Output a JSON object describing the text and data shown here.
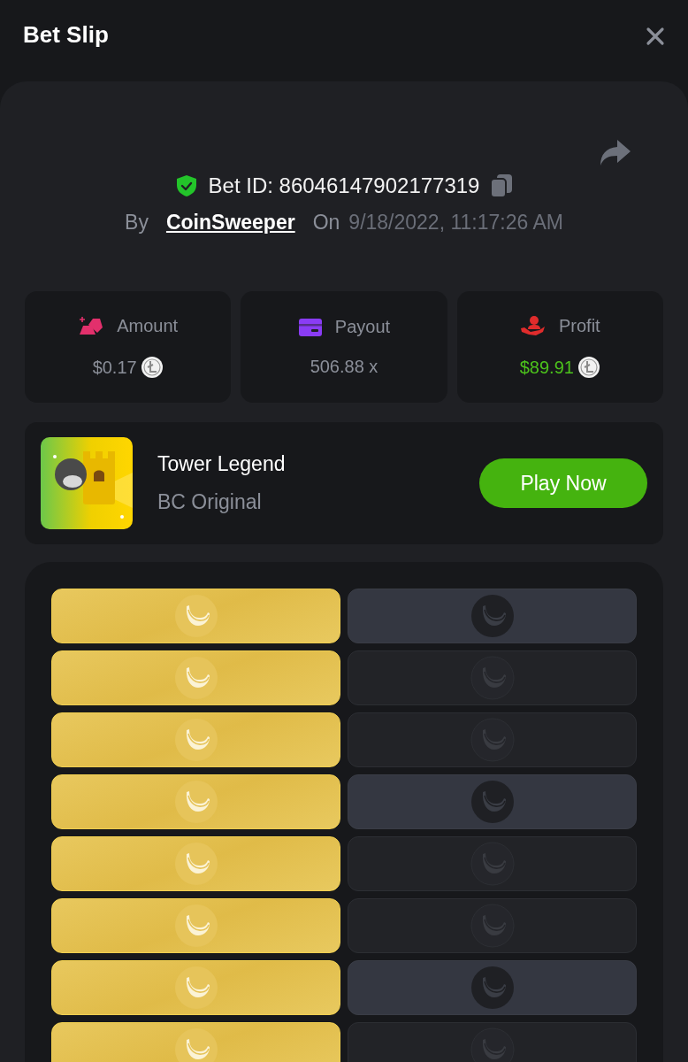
{
  "header": {
    "title": "Bet Slip"
  },
  "bet": {
    "id_label": "Bet ID: 86046147902177319",
    "by_label": "By",
    "user": "CoinSweeper",
    "on_label": "On",
    "datetime": "9/18/2022, 11:17:26 AM"
  },
  "stats": [
    {
      "kind": "amount",
      "label": "Amount",
      "value": "$0.17",
      "coin": true,
      "positive": false
    },
    {
      "kind": "payout",
      "label": "Payout",
      "value": "506.88 x",
      "coin": false,
      "positive": false
    },
    {
      "kind": "profit",
      "label": "Profit",
      "value": "$89.91",
      "coin": true,
      "positive": true
    }
  ],
  "game": {
    "kind": "picture",
    "title": "Tower Legend",
    "subtitle": "BC Original",
    "button": "Play Now"
  },
  "grid": [
    {
      "tiles": [
        {
          "picked": true
        },
        {
          "picked": false,
          "revealed": true
        }
      ]
    },
    {
      "tiles": [
        {
          "picked": true
        },
        {
          "picked": false,
          "revealed": false
        }
      ]
    },
    {
      "tiles": [
        {
          "picked": true
        },
        {
          "picked": false,
          "revealed": false
        }
      ]
    },
    {
      "tiles": [
        {
          "picked": true
        },
        {
          "picked": false,
          "revealed": true
        }
      ]
    },
    {
      "tiles": [
        {
          "picked": true
        },
        {
          "picked": false,
          "revealed": false
        }
      ]
    },
    {
      "tiles": [
        {
          "picked": true
        },
        {
          "picked": false,
          "revealed": false
        }
      ]
    },
    {
      "tiles": [
        {
          "picked": true
        },
        {
          "picked": false,
          "revealed": true
        }
      ]
    },
    {
      "tiles": [
        {
          "picked": true
        },
        {
          "picked": false,
          "revealed": false
        }
      ]
    }
  ]
}
